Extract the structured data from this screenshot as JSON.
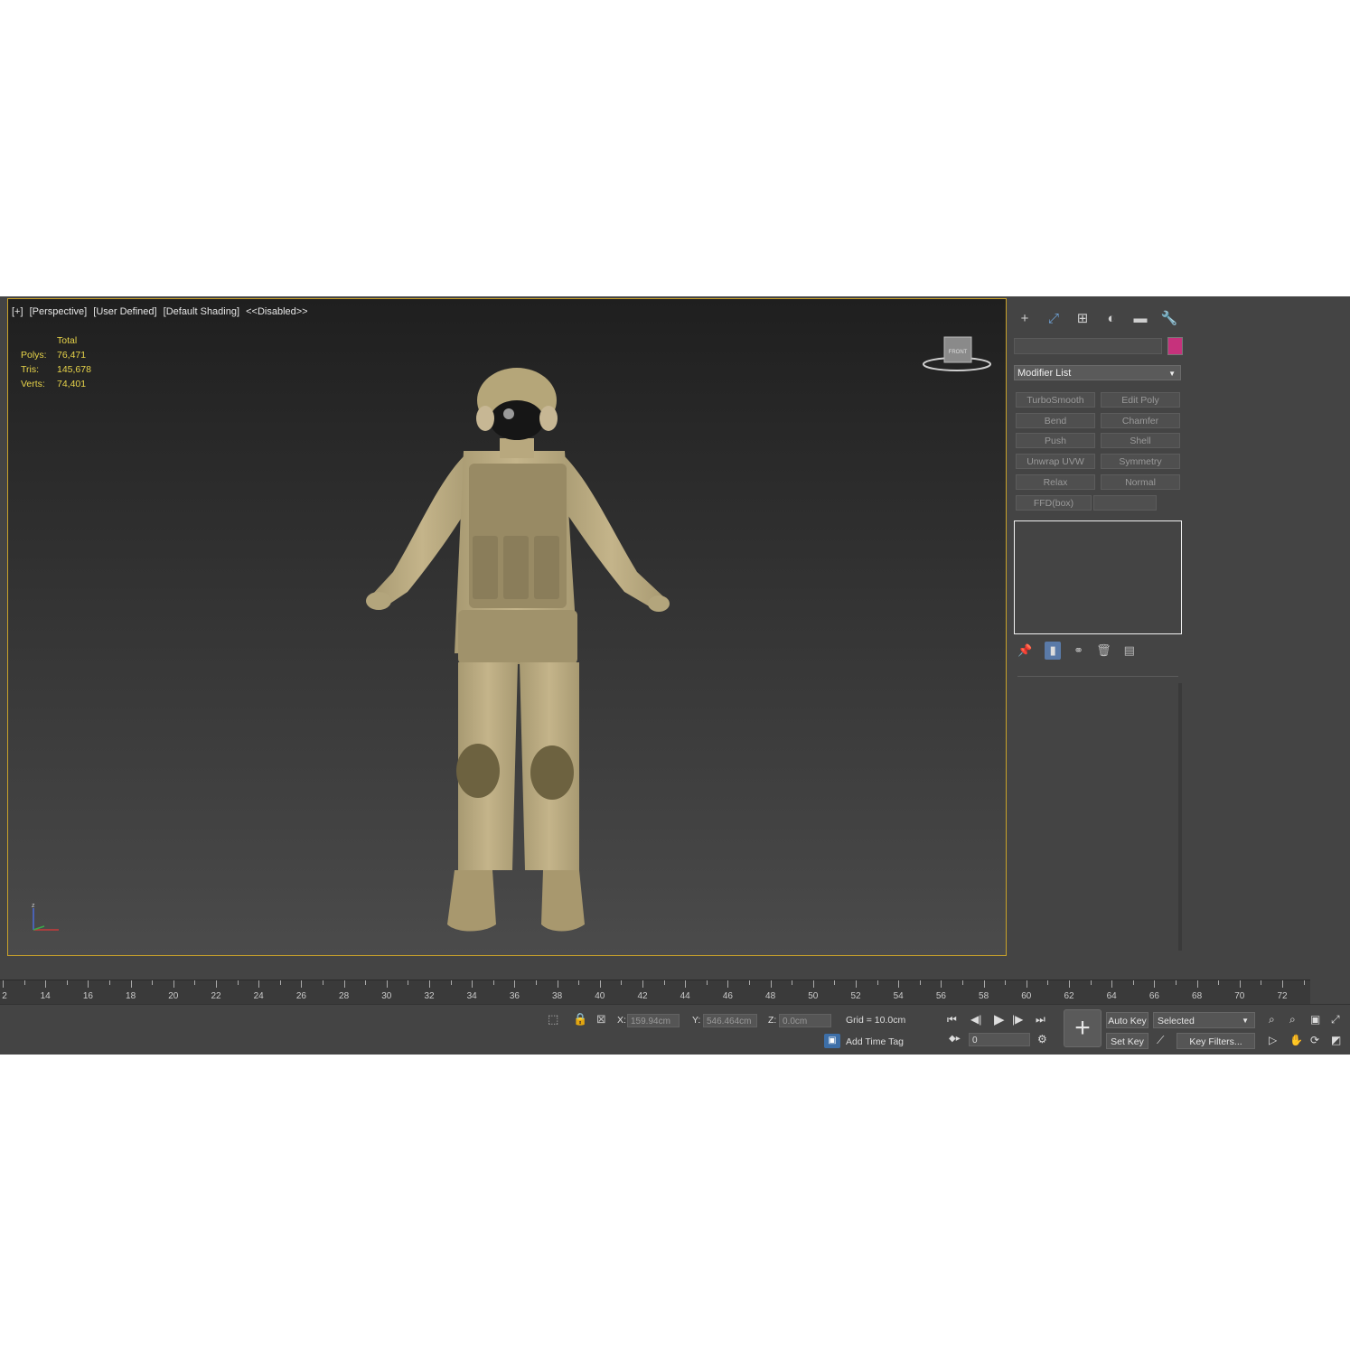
{
  "viewport": {
    "labels": [
      "[+]",
      "[Perspective]",
      "[User Defined]",
      "[Default Shading]",
      "<<Disabled>>"
    ],
    "stats": {
      "header": "Total",
      "rows": [
        {
          "label": "Polys:",
          "value": "76,471"
        },
        {
          "label": "Tris:",
          "value": "145,678"
        },
        {
          "label": "Verts:",
          "value": "74,401"
        }
      ]
    },
    "viewcube_face": "FRONT",
    "axis": {
      "z": "z"
    }
  },
  "panel": {
    "tabs": [
      {
        "icon": "plus-icon",
        "glyph": "+"
      },
      {
        "icon": "modify-icon",
        "glyph": "⤢"
      },
      {
        "icon": "hierarchy-icon",
        "glyph": "⊞"
      },
      {
        "icon": "motion-icon",
        "glyph": "◐"
      },
      {
        "icon": "display-icon",
        "glyph": "▬"
      },
      {
        "icon": "utilities-icon",
        "glyph": "🔧"
      }
    ],
    "modifier_list": "Modifier List",
    "modifiers": [
      "TurboSmooth",
      "Edit Poly",
      "Bend",
      "Chamfer",
      "Push",
      "Shell",
      "Unwrap UVW",
      "Symmetry",
      "Relax",
      "Normal",
      "FFD(box)",
      ""
    ],
    "colors": {
      "object_color": "#c6327c",
      "accent": "#c9a22a"
    }
  },
  "timeline": {
    "labels": [
      "2",
      "14",
      "16",
      "18",
      "20",
      "22",
      "24",
      "26",
      "28",
      "30",
      "32",
      "34",
      "36",
      "38",
      "40",
      "42",
      "44",
      "46",
      "48",
      "50",
      "52",
      "54",
      "56",
      "58",
      "60",
      "62",
      "64",
      "66",
      "68",
      "70",
      "72"
    ]
  },
  "status": {
    "x_label": "X:",
    "x_value": "159.94cm",
    "y_label": "Y:",
    "y_value": "546.464cm",
    "z_label": "Z:",
    "z_value": "0.0cm",
    "grid": "Grid = 10.0cm",
    "add_time_tag": "Add Time Tag",
    "frame": "0",
    "auto_key": "Auto Key",
    "set_key": "Set Key",
    "selected": "Selected",
    "key_filters": "Key Filters..."
  }
}
